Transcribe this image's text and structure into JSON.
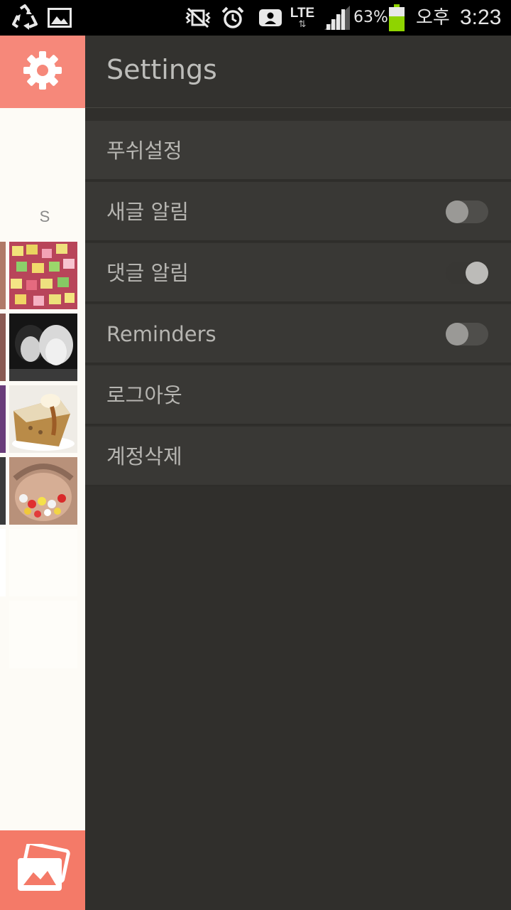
{
  "status_bar": {
    "left_icons": [
      "recycle-icon",
      "image-icon"
    ],
    "right_icons": [
      "vibrate-off-icon",
      "alarm-icon",
      "screen-mirror-icon",
      "lte-icon",
      "signal-icon",
      "battery-icon"
    ],
    "network": "LTE",
    "battery_percent": "63%",
    "battery_level": 0.63,
    "ampm": "오후",
    "time": "3:23"
  },
  "left_strip": {
    "gear_icon": "gear-icon",
    "letter": "S",
    "gallery_icon": "gallery-icon"
  },
  "settings": {
    "title": "Settings",
    "items": [
      {
        "label": "푸쉬설정",
        "type": "section"
      },
      {
        "label": "새글 알림",
        "type": "toggle",
        "on": false
      },
      {
        "label": "댓글 알림",
        "type": "toggle",
        "on": true
      },
      {
        "label": "Reminders",
        "type": "toggle",
        "on": false
      },
      {
        "label": "로그아웃",
        "type": "action"
      },
      {
        "label": "계정삭제",
        "type": "action"
      }
    ]
  },
  "colors": {
    "accent": "#f6887a",
    "drawer_bg": "#302f2c",
    "row_bg": "#393835",
    "battery": "#8fd400"
  }
}
